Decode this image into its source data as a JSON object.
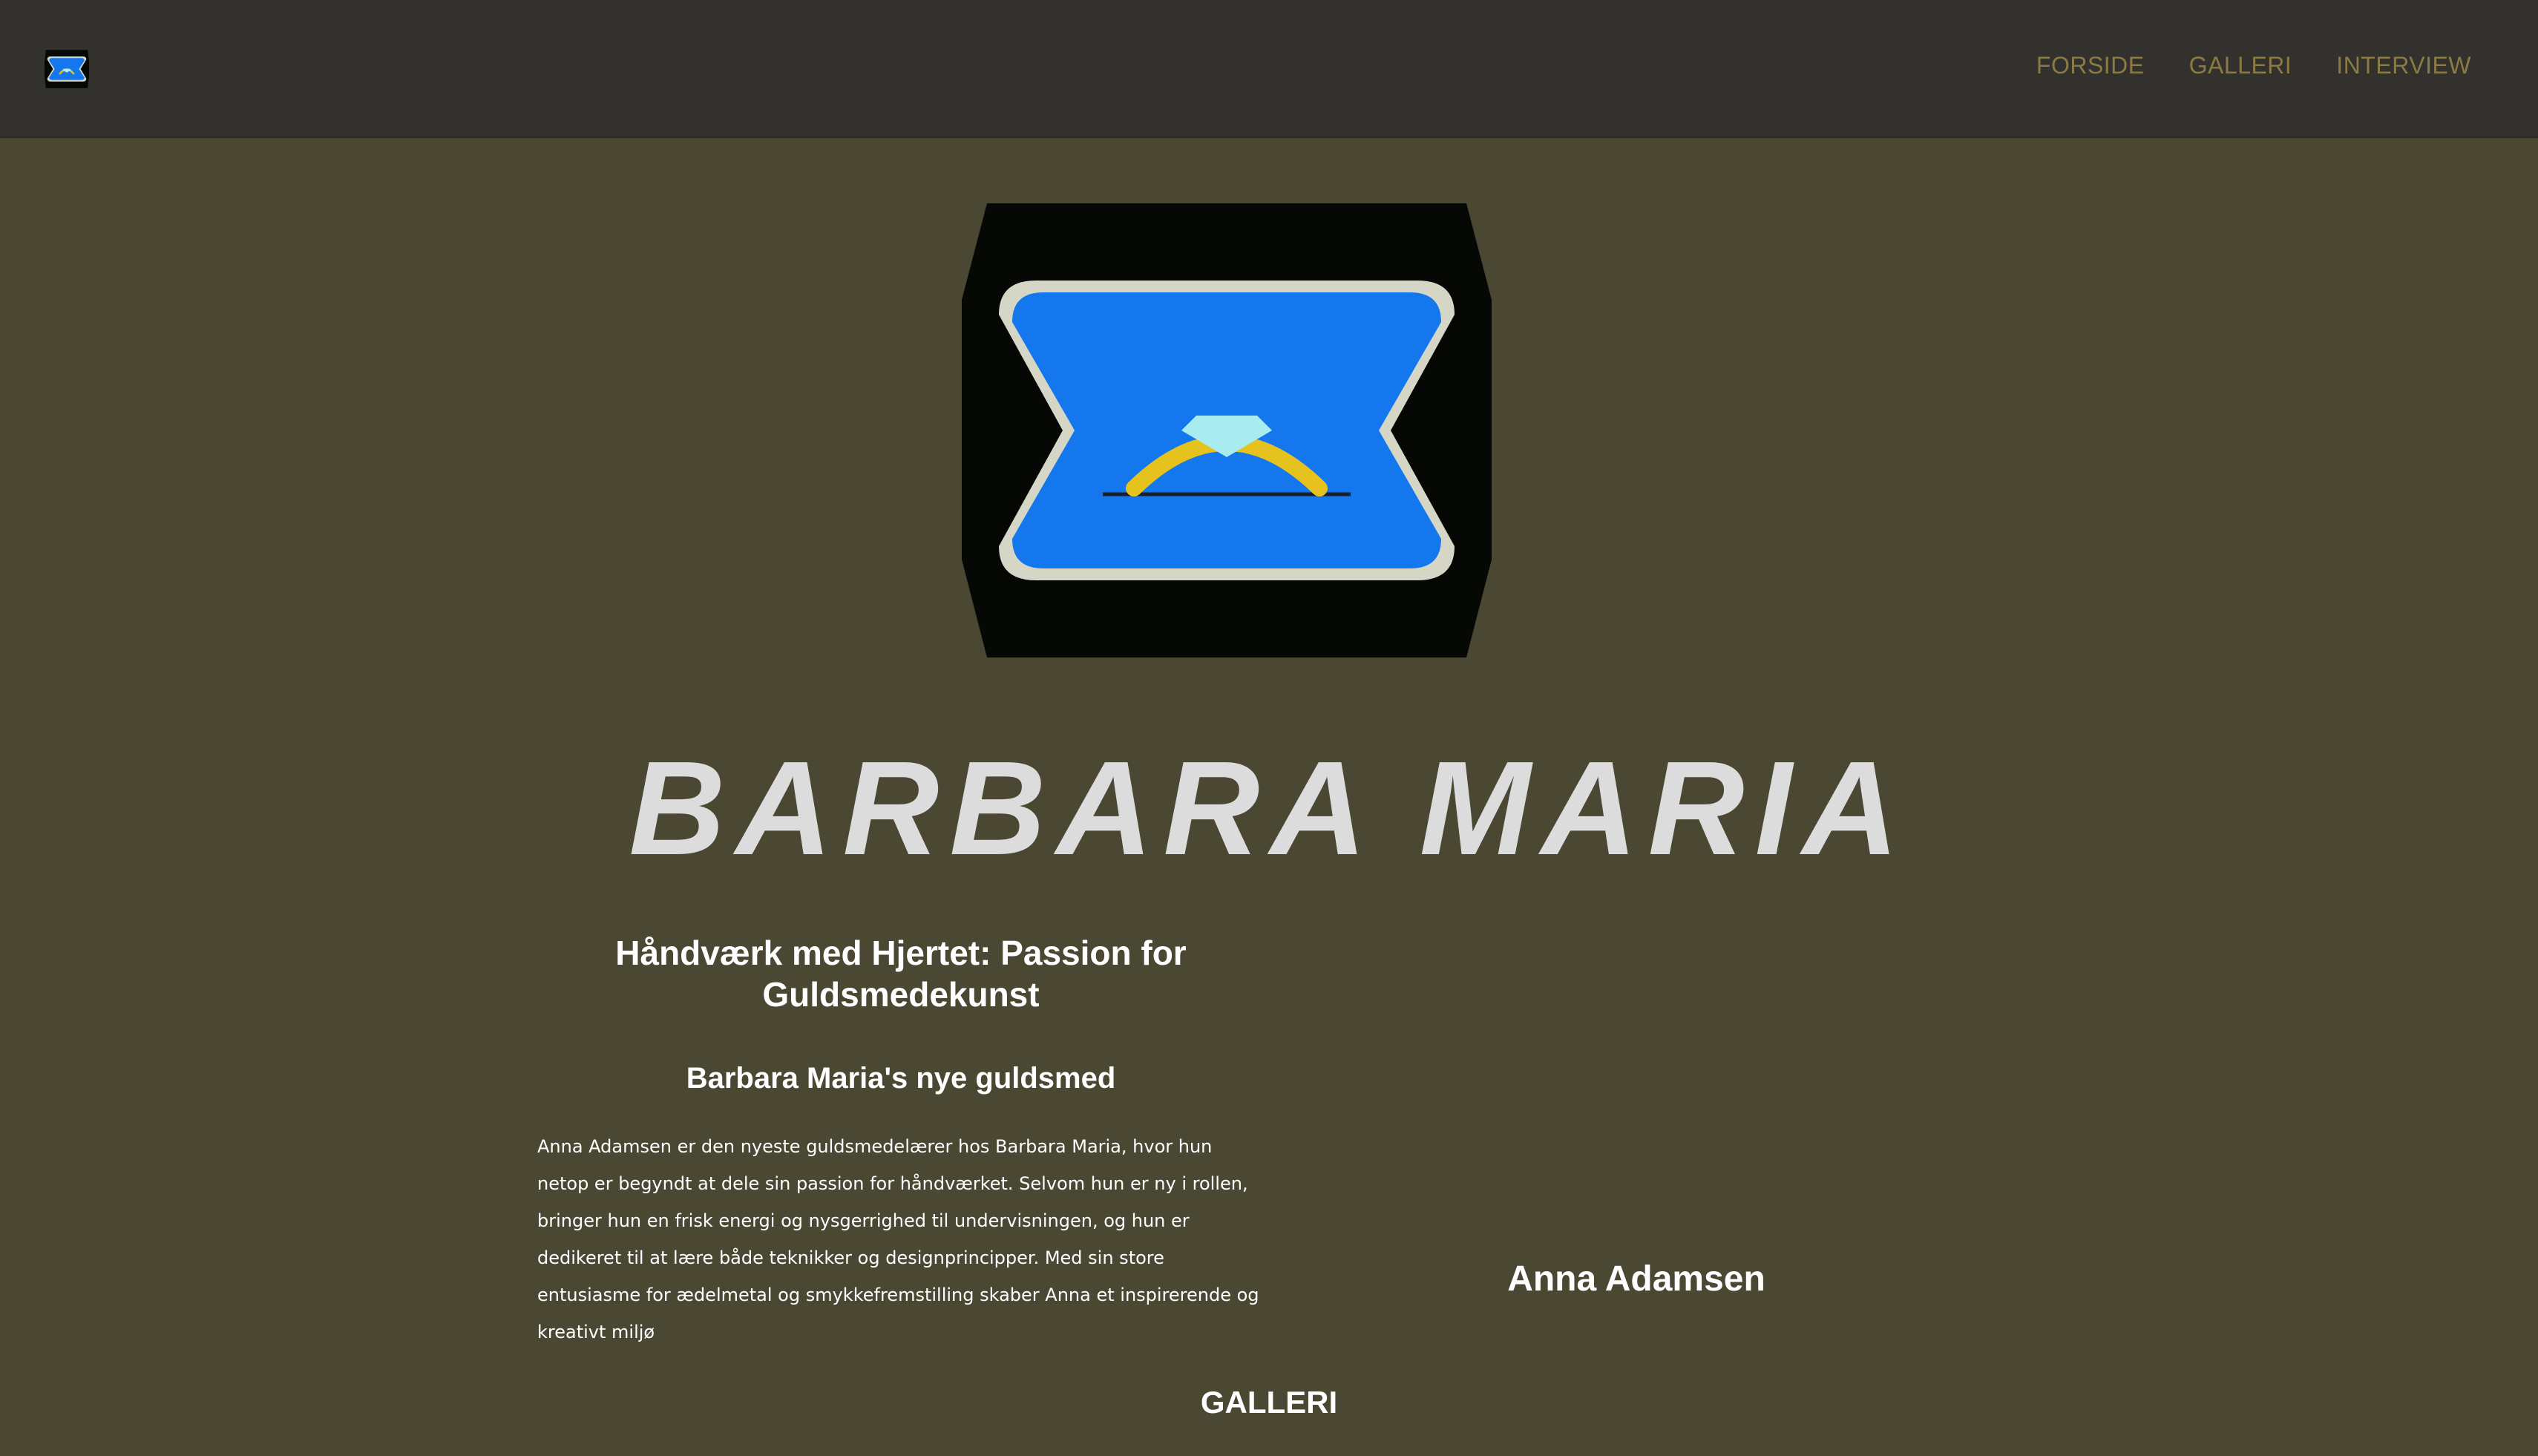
{
  "header": {
    "logo_icon": "ring-box-icon",
    "nav": {
      "forside": "FORSIDE",
      "galleri": "GALLERI",
      "interview": "INTERVIEW"
    }
  },
  "hero": {
    "logo_icon": "ring-box-icon",
    "brand": "BARBARA MARIA"
  },
  "article": {
    "heading": "Håndværk med Hjertet: Passion for Guldsmedekunst",
    "subheading": "Barbara Maria's nye guldsmed",
    "body": "Anna Adamsen er den nyeste guldsmedelærer hos Barbara Maria, hvor hun netop er begyndt at dele sin passion for håndværket. Selvom hun er ny i rollen, bringer hun en frisk energi og nysgerrighed til undervisningen, og hun er dedikeret til at lære både teknikker og designprincipper. Med sin store entusiasme for ædelmetal og smykkefremstilling skaber Anna et inspirerende og kreativt miljø",
    "person_name": "Anna Adamsen"
  },
  "gallery": {
    "heading": "GALLERI"
  },
  "colors": {
    "header_bg": "#32312d",
    "page_bg": "#4a4733",
    "nav_text": "#8a7a45",
    "brand_text": "#dcdcdc",
    "box_blue": "#1577ee",
    "box_black": "#060806",
    "ring_gold": "#e6c21e",
    "diamond": "#a8ecf0"
  }
}
